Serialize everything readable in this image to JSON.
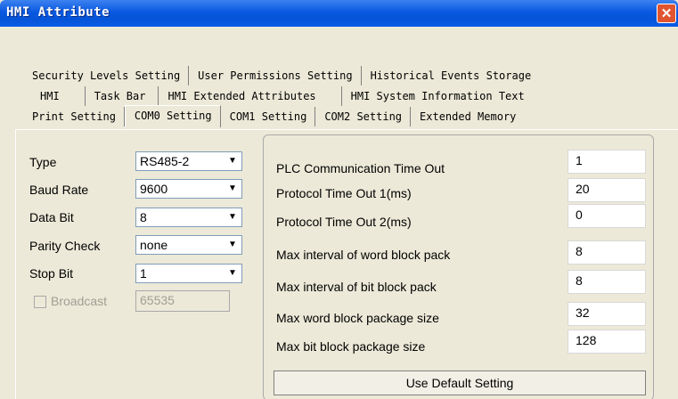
{
  "window": {
    "title": "HMI Attribute",
    "close_label": "✕"
  },
  "tabs": {
    "row1": [
      "Security Levels Setting",
      "User Permissions Setting",
      "Historical Events Storage"
    ],
    "row2": [
      "HMI",
      "Task Bar",
      "HMI Extended Attributes",
      "HMI System Information Text"
    ],
    "row3": [
      "Print Setting",
      "COM0 Setting",
      "COM1 Setting",
      "COM2 Setting",
      "Extended Memory"
    ]
  },
  "com": {
    "type": {
      "label": "Type",
      "value": "RS485-2"
    },
    "baud_rate": {
      "label": "Baud Rate",
      "value": "9600"
    },
    "data_bit": {
      "label": "Data Bit",
      "value": "8"
    },
    "parity_check": {
      "label": "Parity Check",
      "value": "none"
    },
    "stop_bit": {
      "label": "Stop Bit",
      "value": "1"
    },
    "broadcast": {
      "label": "Broadcast",
      "value": "65535",
      "checked": false
    }
  },
  "timing": [
    {
      "label": "PLC Communication Time Out",
      "value": "1"
    },
    {
      "label": "Protocol Time Out 1(ms)",
      "value": "20"
    },
    {
      "label": "Protocol Time Out 2(ms)",
      "value": "0"
    },
    {
      "label": "Max interval of word block pack",
      "value": "8"
    },
    {
      "label": "Max interval of bit block pack",
      "value": "8"
    },
    {
      "label": "Max word block package size",
      "value": "32"
    },
    {
      "label": "Max bit block package size",
      "value": "128"
    }
  ],
  "default_button": "Use Default Setting",
  "icons": {
    "dropdown": "chevron-down-icon",
    "close": "close-icon",
    "checkbox": "checkbox-icon"
  }
}
